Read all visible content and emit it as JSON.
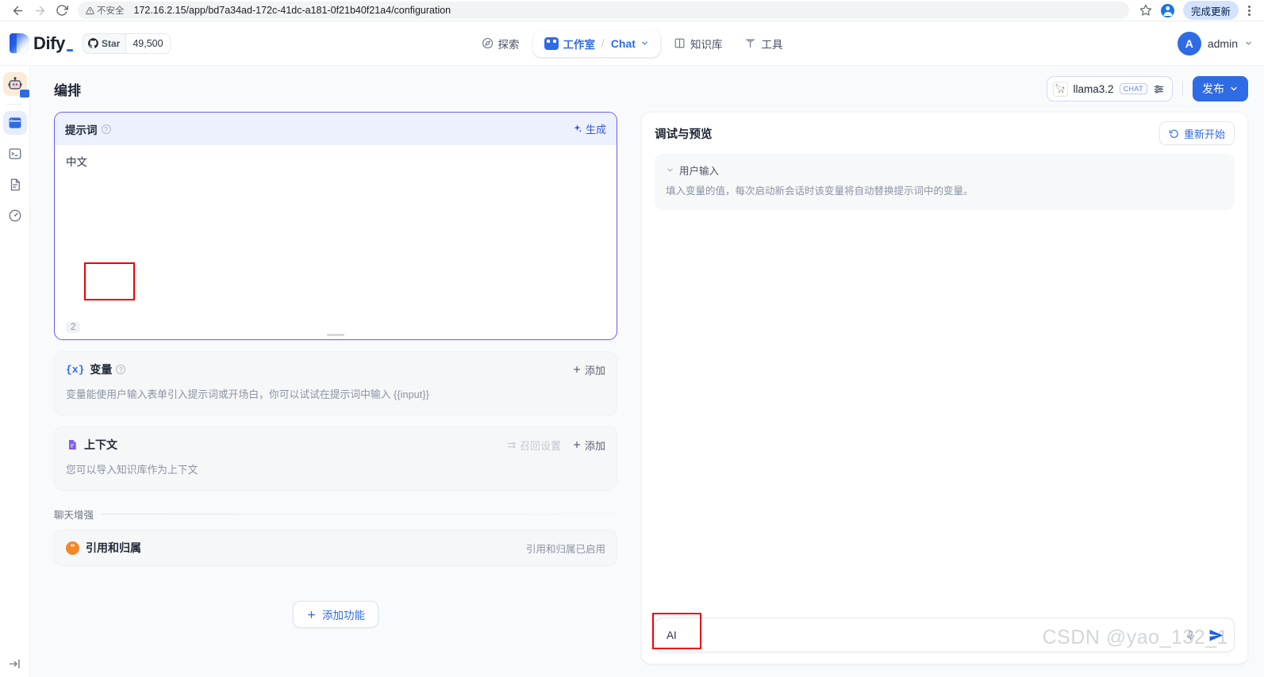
{
  "browser": {
    "back_icon": "back-arrow-icon",
    "forward_icon": "forward-arrow-icon",
    "reload_icon": "reload-icon",
    "security_label": "不安全",
    "url": "172.16.2.15/app/bd7a34ad-172c-41dc-a181-0f21b40f21a4/configuration",
    "bookmark_icon": "star-icon",
    "profile_icon": "profile-avatar-icon",
    "update_label": "完成更新",
    "menu_icon": "kebab-menu-icon"
  },
  "header": {
    "logo_text": "Dify",
    "star_label": "Star",
    "star_count": "49,500",
    "github_icon": "github-icon",
    "nav": [
      {
        "label": "探索",
        "icon": "compass-icon"
      },
      {
        "label": "工作室",
        "icon": "robot-icon",
        "sep": "/",
        "sub_label": "Chat",
        "chevron": "chevron-down-icon"
      },
      {
        "label": "知识库",
        "icon": "book-icon"
      },
      {
        "label": "工具",
        "icon": "tool-icon"
      }
    ],
    "user": {
      "initial": "A",
      "name": "admin",
      "chevron": "chevron-down-icon"
    }
  },
  "rail": {
    "app_icon": "app-robot-icon",
    "items": [
      {
        "name": "orchestrate",
        "icon": "window-icon",
        "active": true
      },
      {
        "name": "api-access",
        "icon": "terminal-icon",
        "active": false
      },
      {
        "name": "logs",
        "icon": "document-icon",
        "active": false
      },
      {
        "name": "monitoring",
        "icon": "gauge-icon",
        "active": false
      }
    ],
    "collapse_icon": "expand-sidebar-icon"
  },
  "page": {
    "title": "编排",
    "model": {
      "icon": "llama-icon",
      "name": "llama3.2",
      "badge": "CHAT",
      "params_icon": "sliders-icon"
    },
    "publish": {
      "label": "发布",
      "chevron": "chevron-down-icon"
    }
  },
  "prompt": {
    "title": "提示词",
    "info_icon": "info-icon",
    "generate_label": "生成",
    "generate_icon": "sparkle-icon",
    "text": "中文",
    "char_count": "2",
    "drag_handle": "resize-handle"
  },
  "variables": {
    "icon": "{x}",
    "title": "变量",
    "info_icon": "info-icon",
    "add_label": "添加",
    "description": "变量能使用户输入表单引入提示词或开场白，你可以试试在提示词中输入 {{input}}"
  },
  "context": {
    "icon": "context-doc-icon",
    "title": "上下文",
    "recall_label": "召回设置",
    "recall_icon": "recall-settings-icon",
    "add_label": "添加",
    "description": "您可以导入知识库作为上下文"
  },
  "chat_enhance": {
    "section_label": "聊天增强",
    "item": {
      "icon": "quote-icon",
      "title": "引用和归属",
      "status": "引用和归属已启用"
    }
  },
  "add_feature": {
    "label": "添加功能",
    "icon": "plus-icon"
  },
  "preview": {
    "title": "调试与预览",
    "restart_label": "重新开始",
    "restart_icon": "refresh-icon",
    "user_input": {
      "chevron": "chevron-down-icon",
      "title": "用户输入",
      "description": "填入变量的值，每次启动新会话时该变量将自动替换提示词中的变量。"
    },
    "chat_input": {
      "value": "AI",
      "send_icon": "send-icon",
      "mic_icon": "microphone-icon"
    }
  },
  "watermark": "CSDN @yao_132_1",
  "colors": {
    "accent": "#2f6be4",
    "prompt_border": "#6b5cf6",
    "annotation": "#ee0000",
    "orange": "#f0882c"
  }
}
